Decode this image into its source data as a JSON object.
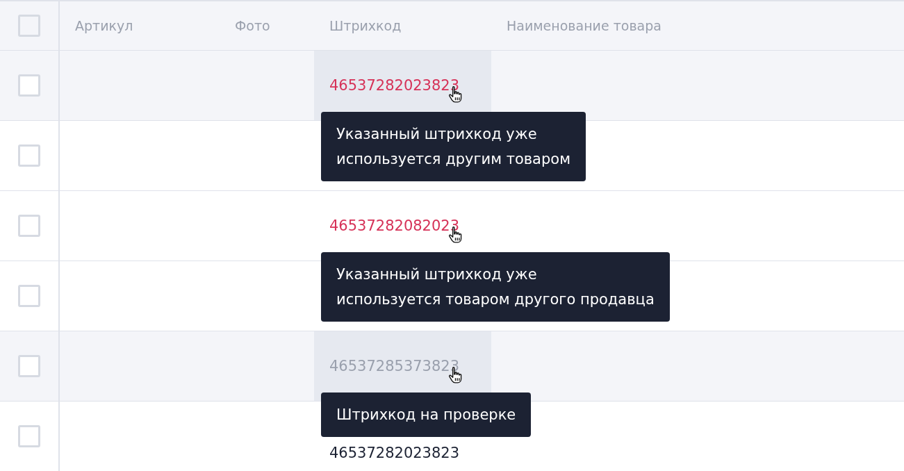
{
  "table": {
    "select_all": {
      "checked": false
    },
    "columns": [
      "Артикул",
      "Фото",
      "Штрихкод",
      "Наименование товара"
    ],
    "rows": [
      {
        "checked": false,
        "barcode": {
          "text": "46537282023823",
          "kind": "error",
          "hovered": true,
          "tooltip": [
            "Указанный штрихкод уже",
            "используется другим товаром"
          ]
        }
      },
      {
        "checked": false
      },
      {
        "checked": false,
        "barcode": {
          "text": "46537282082023",
          "kind": "error",
          "hovered": false,
          "tooltip": [
            "Указанный штрихкод уже",
            "используется товаром другого продавца"
          ]
        }
      },
      {
        "checked": false
      },
      {
        "checked": false,
        "barcode": {
          "text": "46537285373823",
          "kind": "pending",
          "hovered": true,
          "tooltip": [
            "Штрихкод на проверке"
          ]
        }
      },
      {
        "checked": false,
        "barcode": {
          "text": "46537282023823",
          "kind": "ok",
          "hovered": false
        }
      }
    ]
  }
}
